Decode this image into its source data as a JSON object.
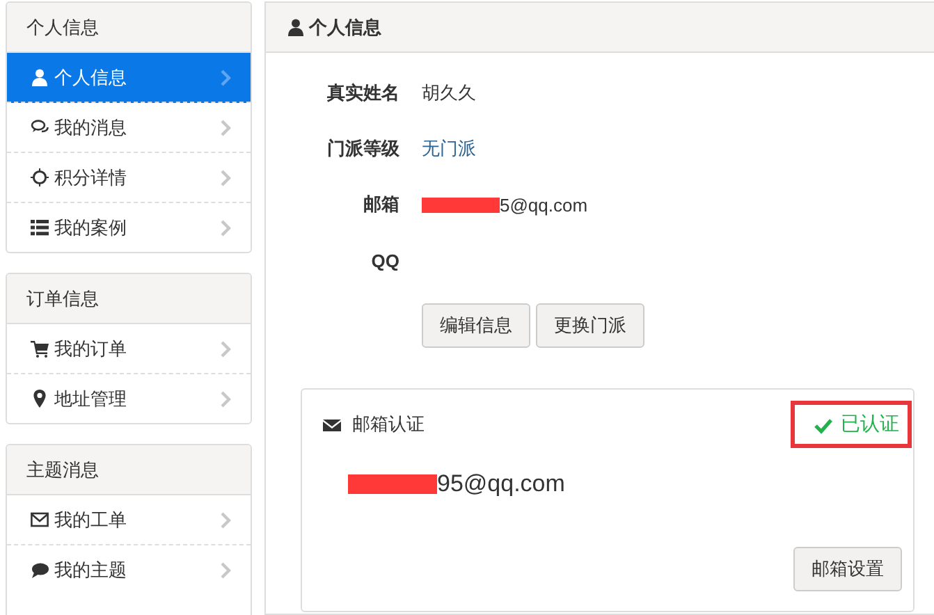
{
  "sidebar": {
    "groups": [
      {
        "title": "个人信息",
        "items": [
          {
            "label": "个人信息",
            "selected": true
          },
          {
            "label": "我的消息",
            "selected": false
          },
          {
            "label": "积分详情",
            "selected": false
          },
          {
            "label": "我的案例",
            "selected": false
          }
        ]
      },
      {
        "title": "订单信息",
        "items": [
          {
            "label": "我的订单",
            "selected": false
          },
          {
            "label": "地址管理",
            "selected": false
          }
        ]
      },
      {
        "title": "主题消息",
        "items": [
          {
            "label": "我的工单",
            "selected": false
          },
          {
            "label": "我的主题",
            "selected": false
          }
        ]
      }
    ]
  },
  "profile": {
    "title": "个人信息",
    "fields": [
      {
        "label": "真实姓名",
        "value": "胡久久",
        "kind": "text"
      },
      {
        "label": "门派等级",
        "value": "无门派",
        "kind": "link"
      },
      {
        "label": "邮箱",
        "value": "5@qq.com",
        "kind": "text",
        "redacted": true
      },
      {
        "label": "QQ"
      }
    ],
    "buttons": [
      "编辑信息",
      "更换门派"
    ]
  },
  "email_card": {
    "title": "邮箱认证",
    "verified": true,
    "status": "已认证",
    "email": "95@qq.com",
    "redacted": true,
    "button": "邮箱设置"
  }
}
